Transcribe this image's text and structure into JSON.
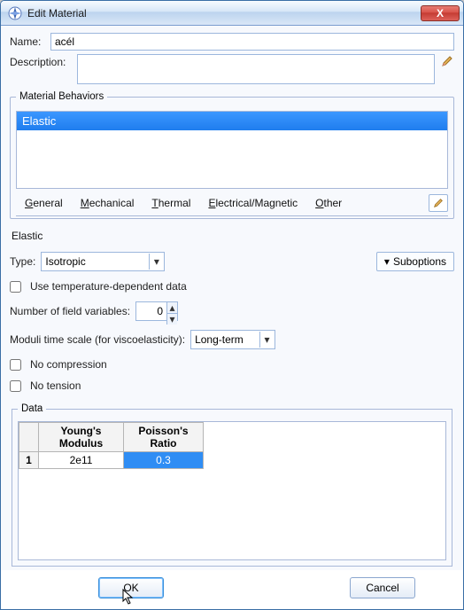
{
  "window": {
    "title": "Edit Material"
  },
  "fields": {
    "name_label": "Name:",
    "name_value": "acél",
    "description_label": "Description:",
    "description_value": ""
  },
  "behaviors": {
    "group_label": "Material Behaviors",
    "items": [
      "Elastic"
    ]
  },
  "tabs": {
    "general": "General",
    "mechanical": "Mechanical",
    "thermal": "Thermal",
    "electrical": "Electrical/Magnetic",
    "other": "Other"
  },
  "elastic": {
    "heading": "Elastic",
    "type_label": "Type:",
    "type_value": "Isotropic",
    "suboptions_label": "Suboptions",
    "use_temp_label": "Use temperature-dependent data",
    "field_vars_label": "Number of field variables:",
    "field_vars_value": "0",
    "moduli_label": "Moduli time scale (for viscoelasticity):",
    "moduli_value": "Long-term",
    "no_compression_label": "No compression",
    "no_tension_label": "No tension"
  },
  "data": {
    "group_label": "Data",
    "columns": [
      "Young's\nModulus",
      "Poisson's\nRatio"
    ],
    "col0_l1": "Young's",
    "col0_l2": "Modulus",
    "col1_l1": "Poisson's",
    "col1_l2": "Ratio",
    "rows": [
      {
        "n": "1",
        "ym": "2e11",
        "pr": "0.3"
      }
    ]
  },
  "buttons": {
    "ok": "OK",
    "cancel": "Cancel"
  },
  "icons": {
    "close": "X",
    "pencil": "✎",
    "down": "▾",
    "up": "▴"
  }
}
